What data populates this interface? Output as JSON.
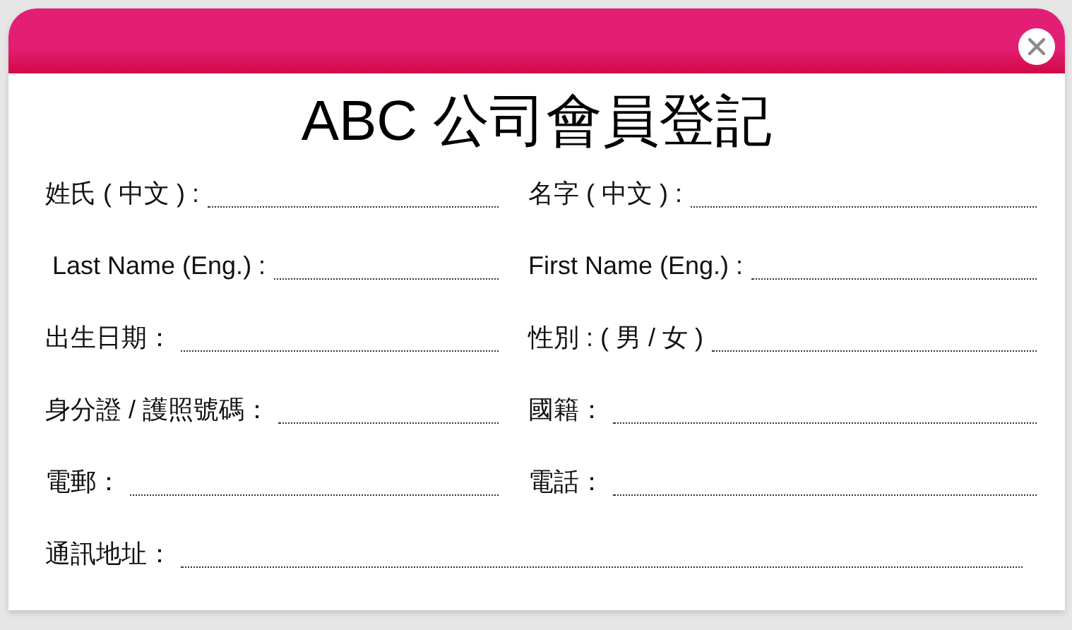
{
  "dialog": {
    "title": "ABC 公司會員登記"
  },
  "fields": [
    {
      "label": "姓氏 ( 中文 ) :",
      "kind": "half"
    },
    {
      "label": "名字 ( 中文 ) :",
      "kind": "half"
    },
    {
      "label": " Last Name (Eng.) :",
      "kind": "half"
    },
    {
      "label": "First Name (Eng.) :",
      "kind": "half"
    },
    {
      "label": "出生日期：",
      "kind": "half"
    },
    {
      "label": "性別 : ( 男 / 女 )",
      "kind": "half"
    },
    {
      "label": "身分證 / 護照號碼：",
      "kind": "half"
    },
    {
      "label": "國籍：",
      "kind": "half"
    },
    {
      "label": "電郵：",
      "kind": "half"
    },
    {
      "label": "電話：",
      "kind": "half"
    },
    {
      "label": "通訊地址：",
      "kind": "full"
    }
  ]
}
